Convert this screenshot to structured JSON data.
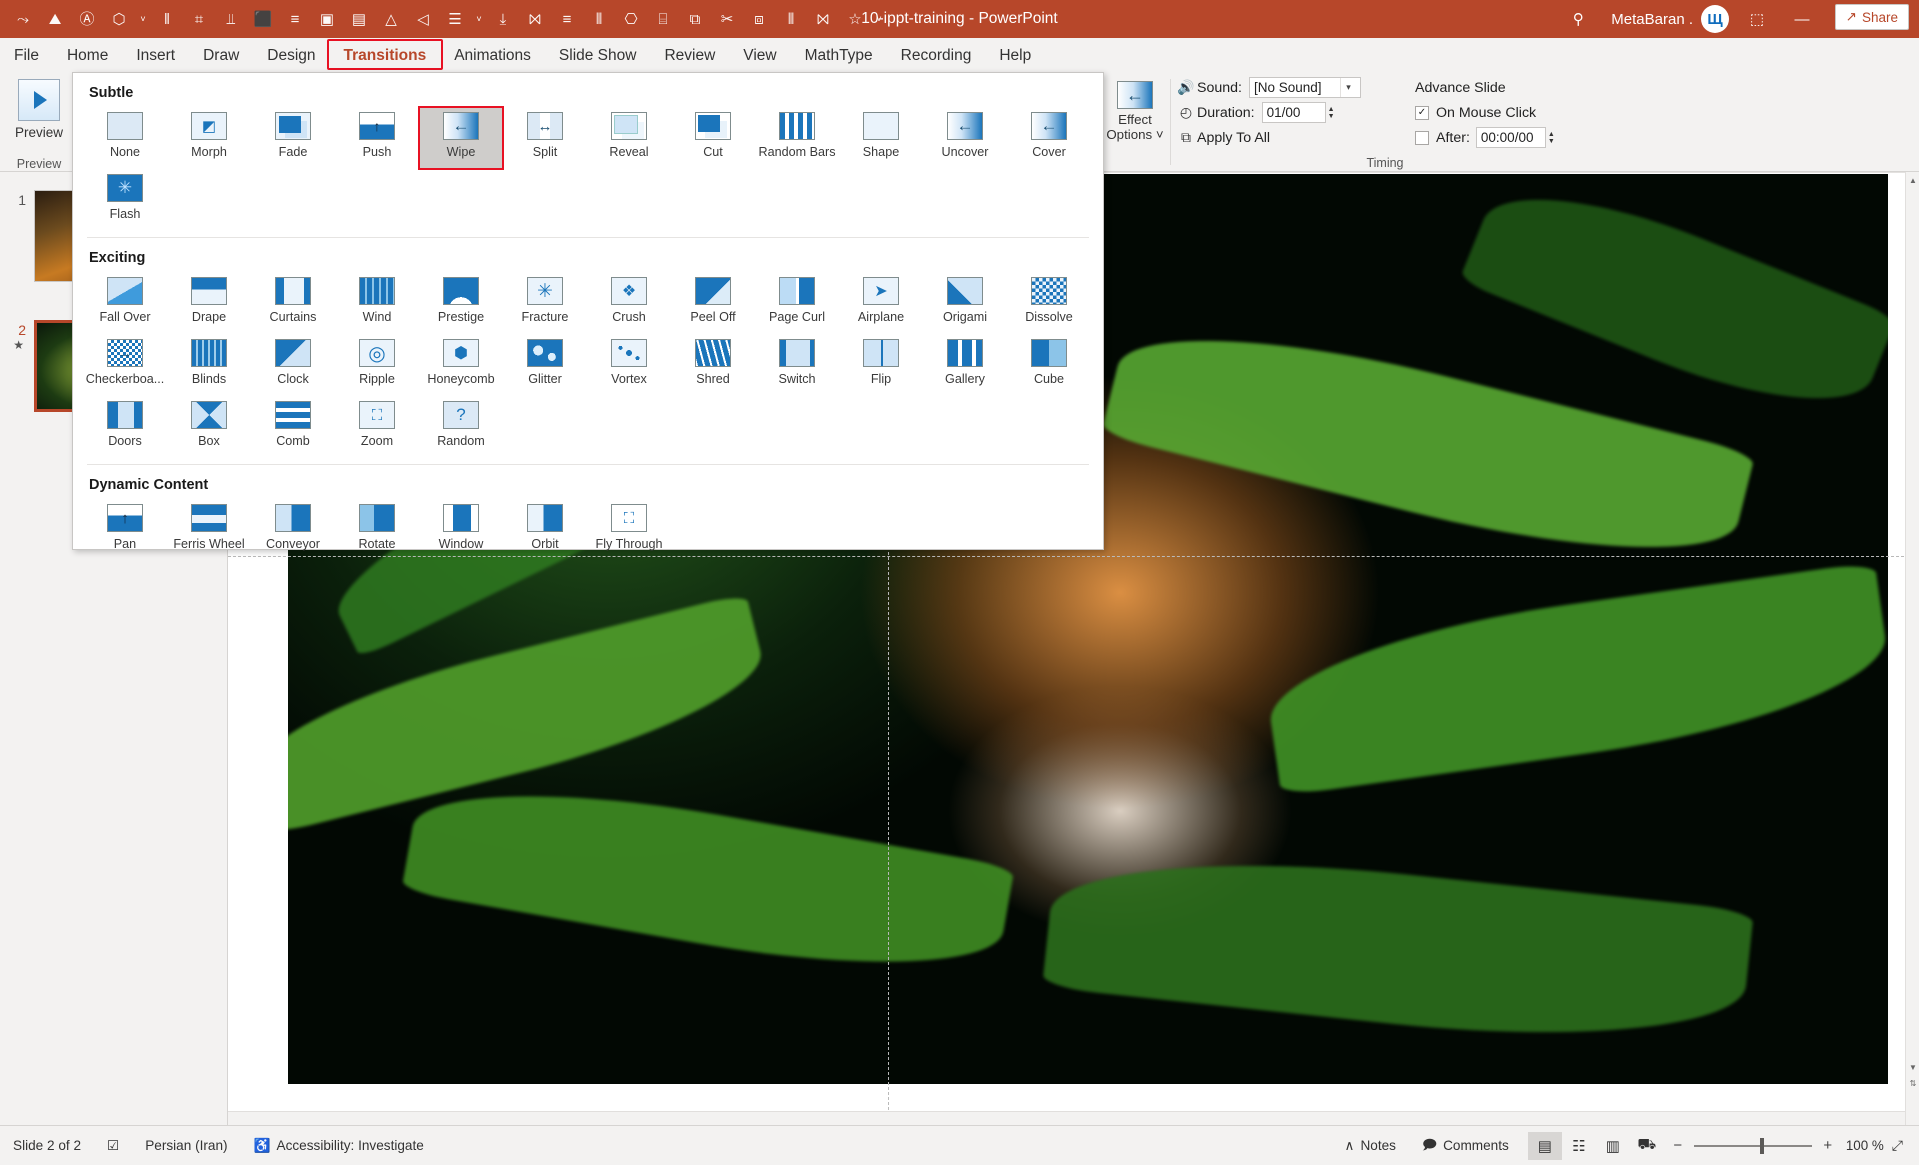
{
  "titlebar": {
    "title": "10-ippt-training  -  PowerPoint",
    "account_name": "MetaBaran .",
    "avatar_glyph": "Щ",
    "search_icon": "⚲",
    "ribbon_display_icon": "⬚",
    "minimize": "—",
    "restore": "❐",
    "close": "✕",
    "qat": [
      {
        "name": "autosave-icon",
        "glyph": "⤳"
      },
      {
        "name": "picture-tools-icon",
        "glyph": "⛰"
      },
      {
        "name": "text-box-icon",
        "glyph": "Ⓐ"
      },
      {
        "name": "shapes-icon",
        "glyph": "⬡"
      },
      {
        "name": "qat-dropdown-caret",
        "glyph": "˅"
      },
      {
        "name": "align-columns-icon",
        "glyph": "‖"
      },
      {
        "name": "crop-icon",
        "glyph": "⌗"
      },
      {
        "name": "distribute-icon",
        "glyph": "⫫"
      },
      {
        "name": "selection-pane-icon",
        "glyph": "⬛"
      },
      {
        "name": "grid-icon",
        "glyph": "≡"
      },
      {
        "name": "bring-forward-icon",
        "glyph": "▣"
      },
      {
        "name": "send-backward-icon",
        "glyph": "▤"
      },
      {
        "name": "flip-vertical-icon",
        "glyph": "△"
      },
      {
        "name": "rotate-left-icon",
        "glyph": "◁"
      },
      {
        "name": "align-objects-icon",
        "glyph": "☰"
      },
      {
        "name": "align-caret",
        "glyph": "˅"
      },
      {
        "name": "align-bottom-icon",
        "glyph": "⤓"
      },
      {
        "name": "align-center-icon",
        "glyph": "⨝"
      },
      {
        "name": "align-left-icon",
        "glyph": "≡"
      },
      {
        "name": "distribute-h-icon",
        "glyph": "⫴"
      },
      {
        "name": "group-icon",
        "glyph": "⎔"
      },
      {
        "name": "ungroup-icon",
        "glyph": "⌸"
      },
      {
        "name": "duplicate-icon",
        "glyph": "⧉"
      },
      {
        "name": "cut-icon",
        "glyph": "✂"
      },
      {
        "name": "size-position-icon",
        "glyph": "⧈"
      },
      {
        "name": "spacing-icon",
        "glyph": "⫴"
      },
      {
        "name": "merge-shapes-icon",
        "glyph": "⨝"
      },
      {
        "name": "format-painter-icon",
        "glyph": "☆"
      },
      {
        "name": "more-commands-caret",
        "glyph": "˅"
      }
    ]
  },
  "tabs": [
    {
      "label": "File",
      "active": false
    },
    {
      "label": "Home",
      "active": false
    },
    {
      "label": "Insert",
      "active": false
    },
    {
      "label": "Draw",
      "active": false
    },
    {
      "label": "Design",
      "active": false
    },
    {
      "label": "Transitions",
      "active": true
    },
    {
      "label": "Animations",
      "active": false
    },
    {
      "label": "Slide Show",
      "active": false
    },
    {
      "label": "Review",
      "active": false
    },
    {
      "label": "View",
      "active": false
    },
    {
      "label": "MathType",
      "active": false
    },
    {
      "label": "Recording",
      "active": false
    },
    {
      "label": "Help",
      "active": false
    }
  ],
  "share": {
    "label": "Share",
    "icon": "↗"
  },
  "ribbon": {
    "preview": {
      "button_label": "Preview",
      "group_label": "Preview"
    },
    "effect_options": {
      "line1": "Effect",
      "line2": "Options ˅"
    },
    "timing": {
      "group_label": "Timing",
      "sound_label": "Sound:",
      "sound_value": "[No Sound]",
      "sound_icon": "🔊",
      "duration_label": "Duration:",
      "duration_value": "01/00",
      "duration_icon": "◴",
      "apply_to_all_label": "Apply To All",
      "apply_to_all_icon": "⧉",
      "advance_slide_label": "Advance Slide",
      "on_mouse_click_label": "On Mouse Click",
      "on_mouse_click_checked": "✓",
      "after_label": "After:",
      "after_value": "00:00/00"
    }
  },
  "gallery": {
    "sections": [
      {
        "title": "Subtle",
        "items": [
          {
            "label": "None",
            "art": "t-none",
            "glyph": "",
            "selected": false
          },
          {
            "label": "Morph",
            "art": "t-morph",
            "glyph": "◩",
            "selected": false
          },
          {
            "label": "Fade",
            "art": "t-fade",
            "glyph": "",
            "selected": false
          },
          {
            "label": "Push",
            "art": "t-push",
            "glyph": "↑",
            "selected": false
          },
          {
            "label": "Wipe",
            "art": "t-wipe",
            "glyph": "←",
            "selected": true
          },
          {
            "label": "Split",
            "art": "t-split",
            "glyph": "↔",
            "selected": false
          },
          {
            "label": "Reveal",
            "art": "t-reveal",
            "glyph": "",
            "selected": false
          },
          {
            "label": "Cut",
            "art": "t-cut",
            "glyph": "",
            "selected": false
          },
          {
            "label": "Random Bars",
            "art": "t-bars",
            "glyph": "",
            "selected": false
          },
          {
            "label": "Shape",
            "art": "t-shape",
            "glyph": "",
            "selected": false
          },
          {
            "label": "Uncover",
            "art": "t-wipe",
            "glyph": "←",
            "selected": false
          },
          {
            "label": "Cover",
            "art": "t-wipe",
            "glyph": "←",
            "selected": false
          },
          {
            "label": "Flash",
            "art": "t-flash",
            "glyph": "✳",
            "selected": false
          }
        ]
      },
      {
        "title": "Exciting",
        "items": [
          {
            "label": "Fall Over",
            "art": "t-fallover",
            "glyph": "",
            "selected": false
          },
          {
            "label": "Drape",
            "art": "t-drape",
            "glyph": "",
            "selected": false
          },
          {
            "label": "Curtains",
            "art": "t-curtains",
            "glyph": "",
            "selected": false
          },
          {
            "label": "Wind",
            "art": "t-wind",
            "glyph": "",
            "selected": false
          },
          {
            "label": "Prestige",
            "art": "t-prestige",
            "glyph": "",
            "selected": false
          },
          {
            "label": "Fracture",
            "art": "t-fracture",
            "glyph": "✳",
            "selected": false
          },
          {
            "label": "Crush",
            "art": "t-crush",
            "glyph": "❖",
            "selected": false
          },
          {
            "label": "Peel Off",
            "art": "t-peel",
            "glyph": "",
            "selected": false
          },
          {
            "label": "Page Curl",
            "art": "t-page",
            "glyph": "",
            "selected": false
          },
          {
            "label": "Airplane",
            "art": "t-plane",
            "glyph": "➤",
            "selected": false
          },
          {
            "label": "Origami",
            "art": "t-origami",
            "glyph": "",
            "selected": false
          },
          {
            "label": "Dissolve",
            "art": "t-dissolve",
            "glyph": "",
            "selected": false
          },
          {
            "label": "Checkerboa...",
            "art": "t-checker",
            "glyph": "→",
            "selected": false
          },
          {
            "label": "Blinds",
            "art": "t-blinds",
            "glyph": "",
            "selected": false
          },
          {
            "label": "Clock",
            "art": "t-clock",
            "glyph": "",
            "selected": false
          },
          {
            "label": "Ripple",
            "art": "t-ripple",
            "glyph": "◎",
            "selected": false
          },
          {
            "label": "Honeycomb",
            "art": "t-honey",
            "glyph": "⬢",
            "selected": false
          },
          {
            "label": "Glitter",
            "art": "t-glitter",
            "glyph": "",
            "selected": false
          },
          {
            "label": "Vortex",
            "art": "t-vortex",
            "glyph": "",
            "selected": false
          },
          {
            "label": "Shred",
            "art": "t-shred",
            "glyph": "",
            "selected": false
          },
          {
            "label": "Switch",
            "art": "t-switch",
            "glyph": "",
            "selected": false
          },
          {
            "label": "Flip",
            "art": "t-flip",
            "glyph": "",
            "selected": false
          },
          {
            "label": "Gallery",
            "art": "t-gallery",
            "glyph": "",
            "selected": false
          },
          {
            "label": "Cube",
            "art": "t-cube",
            "glyph": "",
            "selected": false
          },
          {
            "label": "Doors",
            "art": "t-doors",
            "glyph": "",
            "selected": false
          },
          {
            "label": "Box",
            "art": "t-box",
            "glyph": "",
            "selected": false
          },
          {
            "label": "Comb",
            "art": "t-comb",
            "glyph": "",
            "selected": false
          },
          {
            "label": "Zoom",
            "art": "t-zoom",
            "glyph": "⛶",
            "selected": false
          },
          {
            "label": "Random",
            "art": "t-random",
            "glyph": "?",
            "selected": false
          }
        ]
      },
      {
        "title": "Dynamic Content",
        "items": [
          {
            "label": "Pan",
            "art": "t-pan",
            "glyph": "↑",
            "selected": false
          },
          {
            "label": "Ferris Wheel",
            "art": "t-ferris",
            "glyph": "",
            "selected": false
          },
          {
            "label": "Conveyor",
            "art": "t-conveyor",
            "glyph": "",
            "selected": false
          },
          {
            "label": "Rotate",
            "art": "t-rotate",
            "glyph": "",
            "selected": false
          },
          {
            "label": "Window",
            "art": "t-window",
            "glyph": "",
            "selected": false
          },
          {
            "label": "Orbit",
            "art": "t-orbit",
            "glyph": "",
            "selected": false
          },
          {
            "label": "Fly Through",
            "art": "t-fly",
            "glyph": "⛶",
            "selected": false
          }
        ]
      }
    ]
  },
  "slides_pane": {
    "slides": [
      {
        "number": "1",
        "selected": false,
        "star": ""
      },
      {
        "number": "2",
        "selected": true,
        "star": "★"
      }
    ]
  },
  "statusbar": {
    "slide_count": "Slide 2 of 2",
    "spellcheck_icon": "☑",
    "language": "Persian (Iran)",
    "accessibility_icon": "♿",
    "accessibility": "Accessibility: Investigate",
    "notes_label": "Notes",
    "notes_icon": "∧",
    "comments_label": "Comments",
    "comments_icon": "🗩",
    "views": [
      {
        "name": "normal-view",
        "glyph": "▤",
        "active": true
      },
      {
        "name": "slide-sorter-view",
        "glyph": "☷",
        "active": false
      },
      {
        "name": "reading-view",
        "glyph": "▥",
        "active": false
      },
      {
        "name": "slide-show-view",
        "glyph": "⛟",
        "active": false
      }
    ],
    "zoom_out": "−",
    "zoom_in": "+",
    "zoom_level": "100 %",
    "fit_icon": "⤢"
  }
}
